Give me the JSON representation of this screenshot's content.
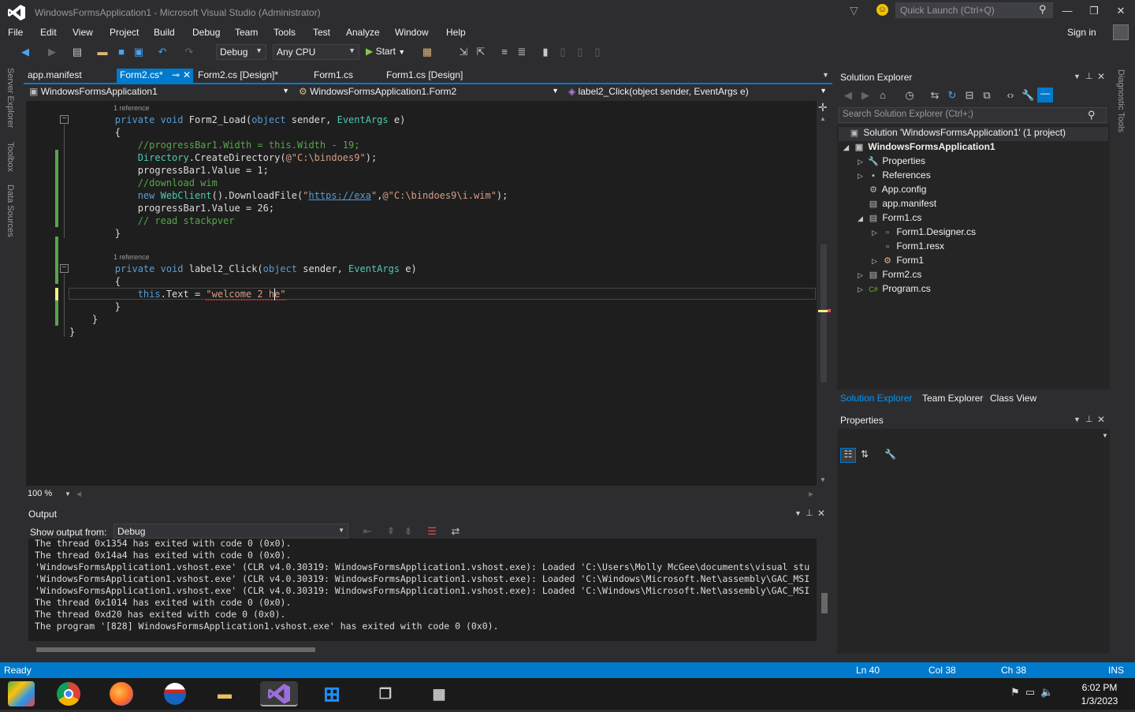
{
  "window": {
    "title": "WindowsFormsApplication1 - Microsoft Visual Studio (Administrator)",
    "quick_launch_placeholder": "Quick Launch (Ctrl+Q)",
    "sign_in": "Sign in"
  },
  "menu": [
    "File",
    "Edit",
    "View",
    "Project",
    "Build",
    "Debug",
    "Team",
    "Tools",
    "Test",
    "Analyze",
    "Window",
    "Help"
  ],
  "toolbar": {
    "config": "Debug",
    "platform": "Any CPU",
    "start_label": "Start"
  },
  "left_strip": [
    "Server Explorer",
    "Toolbox",
    "Data Sources"
  ],
  "right_strip": [
    "Diagnostic Tools"
  ],
  "tabs": [
    {
      "label": "app.manifest",
      "active": false
    },
    {
      "label": "Form2.cs*",
      "active": true
    },
    {
      "label": "Form2.cs [Design]*",
      "active": false
    },
    {
      "label": "Form1.cs",
      "active": false
    },
    {
      "label": "Form1.cs [Design]",
      "active": false
    }
  ],
  "nav": {
    "project": "WindowsFormsApplication1",
    "class": "WindowsFormsApplication1.Form2",
    "member": "label2_Click(object sender, EventArgs e)"
  },
  "code": {
    "ref1": "1 reference",
    "ref2": "1 reference",
    "l1_kw": "private void",
    "l1_name": " Form2_Load(",
    "l1_kw2": "object",
    "l1_rest": " sender, ",
    "l1_ty": "EventArgs",
    "l1_end": " e)",
    "brace_open": "{",
    "c1": "//progressBar1.Width = this.Width - 19;",
    "l3_ty": "Directory",
    "l3_rest": ".CreateDirectory(",
    "l3_str": "@\"C:\\bindoes9\"",
    "l3_end": ");",
    "l4": "progressBar1.Value = 1;",
    "c2": "//download wim",
    "l6_kw": "new",
    "l6_ty": " WebClient",
    "l6_rest": "().DownloadFile(",
    "l6_q1": "\"",
    "l6_link": "https://exa",
    "l6_q2": "\"",
    "l6_comma": ",",
    "l6_str": "@\"C:\\bindoes9\\i.wim\"",
    "l6_end": ");",
    "l7": "progressBar1.Value = 26;",
    "c3": "// read stackpver",
    "brace_close": "}",
    "l2_kw": "private void",
    "l2_name": " label2_Click(",
    "l2_kw2": "object",
    "l2_rest": " sender, ",
    "l2_ty": "EventArgs",
    "l2_end": " e)",
    "brace_open2": "{",
    "cur_kw": "this",
    "cur_rest": ".Text = ",
    "cur_str": "\"welcome 2 he\"",
    "brace_close2": "}",
    "brace_close3": "}",
    "brace_close4": "}"
  },
  "zoom": "100 %",
  "output": {
    "title": "Output",
    "show_from_label": "Show output from:",
    "source": "Debug",
    "lines": [
      "The thread 0x1354 has exited with code 0 (0x0).",
      "The thread 0x14a4 has exited with code 0 (0x0).",
      "'WindowsFormsApplication1.vshost.exe' (CLR v4.0.30319: WindowsFormsApplication1.vshost.exe): Loaded 'C:\\Users\\Molly McGee\\documents\\visual stu",
      "'WindowsFormsApplication1.vshost.exe' (CLR v4.0.30319: WindowsFormsApplication1.vshost.exe): Loaded 'C:\\Windows\\Microsoft.Net\\assembly\\GAC_MSI",
      "'WindowsFormsApplication1.vshost.exe' (CLR v4.0.30319: WindowsFormsApplication1.vshost.exe): Loaded 'C:\\Windows\\Microsoft.Net\\assembly\\GAC_MSI",
      "The thread 0x1014 has exited with code 0 (0x0).",
      "The thread 0xd20 has exited with code 0 (0x0).",
      "The program '[828] WindowsFormsApplication1.vshost.exe' has exited with code 0 (0x0)."
    ]
  },
  "solution_explorer": {
    "title": "Solution Explorer",
    "search_placeholder": "Search Solution Explorer (Ctrl+;)",
    "items": [
      {
        "label": "Solution 'WindowsFormsApplication1' (1 project)",
        "icon": "solution-icon"
      },
      {
        "label": "WindowsFormsApplication1",
        "icon": "csproj-icon"
      },
      {
        "label": "Properties",
        "icon": "wrench-icon"
      },
      {
        "label": "References",
        "icon": "references-icon"
      },
      {
        "label": "App.config",
        "icon": "config-icon"
      },
      {
        "label": "app.manifest",
        "icon": "manifest-icon"
      },
      {
        "label": "Form1.cs",
        "icon": "form-icon"
      },
      {
        "label": "Form1.Designer.cs",
        "icon": "file-icon"
      },
      {
        "label": "Form1.resx",
        "icon": "file-icon"
      },
      {
        "label": "Form1",
        "icon": "class-icon"
      },
      {
        "label": "Form2.cs",
        "icon": "form-icon"
      },
      {
        "label": "Program.cs",
        "icon": "cs-file-icon"
      }
    ],
    "bottom_tabs": [
      "Solution Explorer",
      "Team Explorer",
      "Class View"
    ]
  },
  "properties": {
    "title": "Properties"
  },
  "status": {
    "state": "Ready",
    "ln": "Ln 40",
    "col": "Col 38",
    "ch": "Ch 38",
    "mode": "INS"
  },
  "taskbar": {
    "time": "6:02 PM",
    "date": "1/3/2023"
  },
  "colors": {
    "accent": "#007acc",
    "editor_bg": "#1e1e1e",
    "chrome_bg": "#2d2d30"
  }
}
